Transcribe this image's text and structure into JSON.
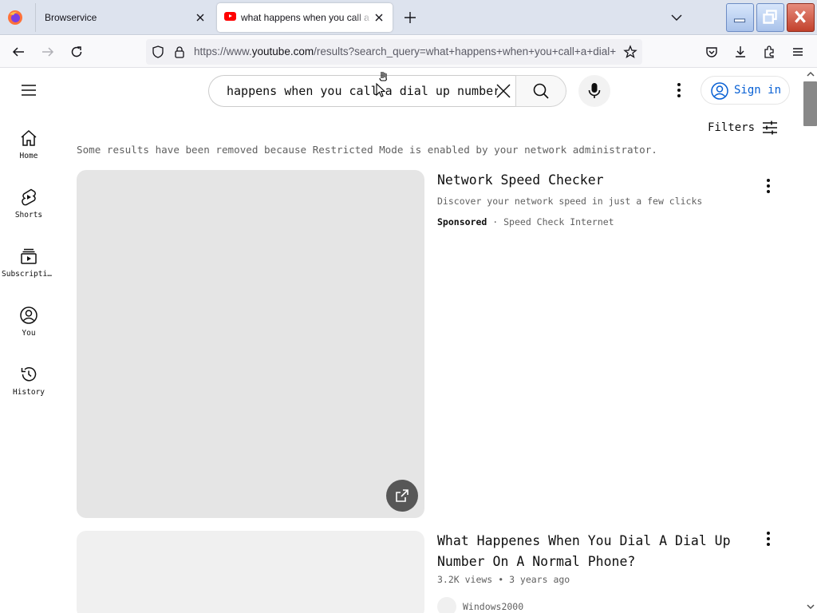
{
  "browser": {
    "tabs": [
      {
        "title": "Browservice",
        "active": false
      },
      {
        "title": "what happens when you call a dial up number",
        "active": true
      }
    ],
    "url": {
      "prefix": "https://www.",
      "host": "youtube.com",
      "path": "/results?search_query=what+happens+when+you+call+a+dial+up+number"
    },
    "icons": [
      "firefox-icon",
      "back-icon",
      "forward-icon",
      "reload-icon",
      "shield-icon",
      "lock-icon",
      "bookmark-star-icon",
      "pocket-icon",
      "download-icon",
      "extensions-icon",
      "menu-icon"
    ]
  },
  "youtube": {
    "search": {
      "query": "happens when you call a dial up number"
    },
    "sign_in_label": "Sign in",
    "guide": [
      {
        "label": "Home",
        "icon": "home-icon"
      },
      {
        "label": "Shorts",
        "icon": "shorts-icon"
      },
      {
        "label": "Subscriptions",
        "icon": "subscriptions-icon"
      },
      {
        "label": "You",
        "icon": "you-icon"
      },
      {
        "label": "History",
        "icon": "history-icon"
      }
    ],
    "filters_label": "Filters",
    "restricted_notice": "Some results have been removed because Restricted Mode is enabled by your network administrator.",
    "results": [
      {
        "type": "ad",
        "title": "Network Speed Checker",
        "description": "Discover your network speed in just a few clicks",
        "sponsored_label": "Sponsored",
        "separator": "·",
        "advertiser": "Speed Check Internet"
      },
      {
        "type": "video",
        "title": "What Happenes When You Dial A Dial Up Number On A Normal Phone?",
        "views": "3.2K views",
        "separator": "•",
        "age": "3 years ago",
        "channel": "Windows2000"
      }
    ]
  },
  "colors": {
    "accent": "#065fd4",
    "youtube_red": "#ff0000",
    "thumbnail_gray": "#e5e5e5"
  }
}
